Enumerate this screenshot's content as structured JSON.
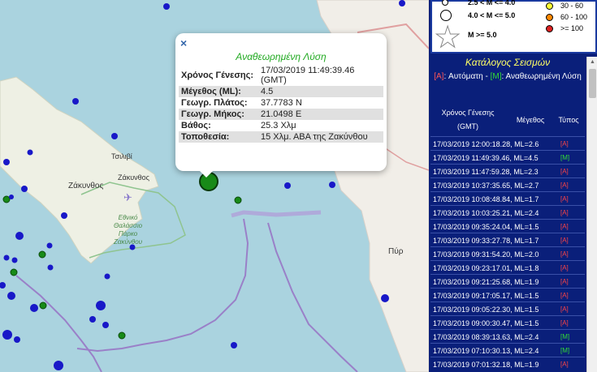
{
  "map": {
    "labels": {
      "tsilivi": "Τσιλιβί",
      "zakynthos_region": "Ζάκυνθος",
      "zakynthos_town": "Ζάκυνθος",
      "park_line1": "Εθνικό",
      "park_line2": "Θαλάσσιο",
      "park_line3": "Πάρκο",
      "park_line4": "Ζακύνθου",
      "pyrgos": "Πύρ"
    }
  },
  "popup": {
    "close": "×",
    "title": "Αναθεωρημένη Λύση",
    "rows": [
      {
        "key": "Χρόνος Γένεσης:",
        "value": "17/03/2019 11:49:39.46 (GMT)"
      },
      {
        "key": "Μέγεθος (ML):",
        "value": "4.5"
      },
      {
        "key": "Γεωγρ. Πλάτος:",
        "value": "37.7783 N"
      },
      {
        "key": "Γεωγρ. Μήκος:",
        "value": "21.0498 E"
      },
      {
        "key": "Βάθος:",
        "value": "25.3 Χλμ"
      },
      {
        "key": "Τοποθεσία:",
        "value": "15 Χλμ. ΑΒΑ της Ζακύνθου"
      }
    ]
  },
  "legend": {
    "row1": "2.5 < M <= 4.0",
    "row2": "4.0 < M <= 5.0",
    "row3": "M >= 5.0",
    "depth1": "30 - 60",
    "depth2": "60 - 100",
    "depth3": ">= 100",
    "colors": {
      "depth1": "#ffff33",
      "depth2": "#ff8800",
      "depth3": "#dd2222"
    }
  },
  "catalog": {
    "title": "Κατάλογος Σεισμών",
    "sub_auto_tag": "[A]",
    "sub_auto_text": ": Αυτόματη - ",
    "sub_rev_tag": "[M]",
    "sub_rev_text": ": Αναθεωρημένη Λύση",
    "col_time_line1": "Χρόνος Γένεσης",
    "col_time_line2": "(GMT)",
    "col_mag": "Μέγεθος",
    "col_type": "Τύπος",
    "rows": [
      {
        "text": "17/03/2019 12:00:18.28, ML=2.6",
        "type": "[A]",
        "cls": "A"
      },
      {
        "text": "17/03/2019 11:49:39.46, ML=4.5",
        "type": "[M]",
        "cls": "M"
      },
      {
        "text": "17/03/2019 11:47:59.28, ML=2.3",
        "type": "[A]",
        "cls": "A"
      },
      {
        "text": "17/03/2019 10:37:35.65, ML=2.7",
        "type": "[A]",
        "cls": "A"
      },
      {
        "text": "17/03/2019 10:08:48.84, ML=1.7",
        "type": "[A]",
        "cls": "A"
      },
      {
        "text": "17/03/2019 10:03:25.21, ML=2.4",
        "type": "[A]",
        "cls": "A"
      },
      {
        "text": "17/03/2019 09:35:24.04, ML=1.5",
        "type": "[A]",
        "cls": "A"
      },
      {
        "text": "17/03/2019 09:33:27.78, ML=1.7",
        "type": "[A]",
        "cls": "A"
      },
      {
        "text": "17/03/2019 09:31:54.20, ML=2.0",
        "type": "[A]",
        "cls": "A"
      },
      {
        "text": "17/03/2019 09:23:17.01, ML=1.8",
        "type": "[A]",
        "cls": "A"
      },
      {
        "text": "17/03/2019 09:21:25.68, ML=1.9",
        "type": "[A]",
        "cls": "A"
      },
      {
        "text": "17/03/2019 09:17:05.17, ML=1.5",
        "type": "[A]",
        "cls": "A"
      },
      {
        "text": "17/03/2019 09:05:22.30, ML=1.5",
        "type": "[A]",
        "cls": "A"
      },
      {
        "text": "17/03/2019 09:00:30.47, ML=1.5",
        "type": "[A]",
        "cls": "A"
      },
      {
        "text": "17/03/2019 08:39:13.63, ML=2.4",
        "type": "[M]",
        "cls": "M"
      },
      {
        "text": "17/03/2019 07:10:30.13, ML=2.4",
        "type": "[M]",
        "cls": "M"
      },
      {
        "text": "17/03/2019 07:01:32.18, ML=1.9",
        "type": "[A]",
        "cls": "A"
      }
    ]
  },
  "scrollbar": {
    "up_arrow": "▲"
  }
}
